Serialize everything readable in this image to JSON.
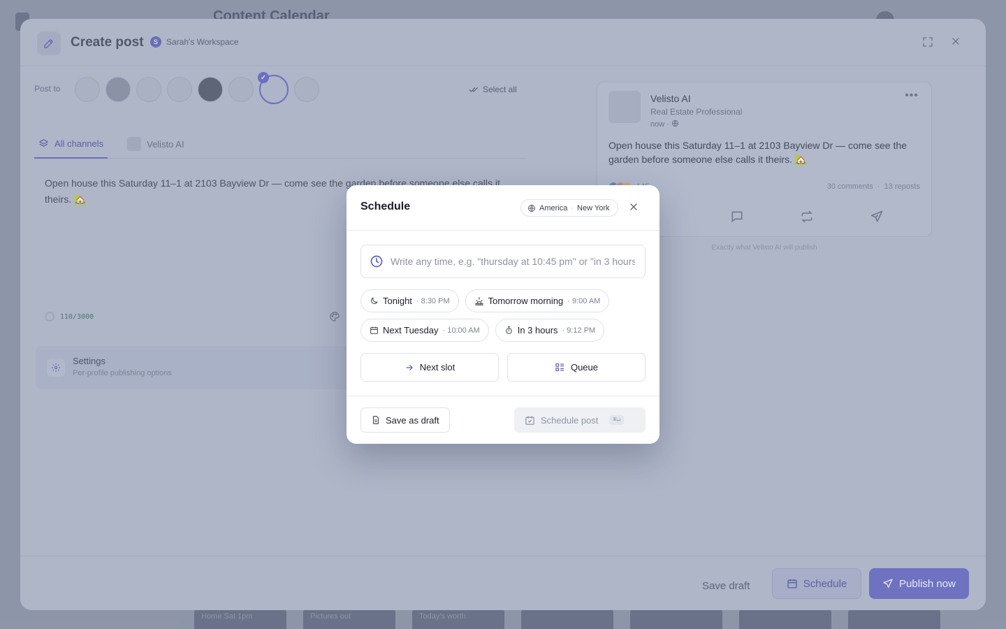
{
  "background": {
    "title": "Content Calendar",
    "cells": [
      "Home Sat 1pm",
      "Pictures out",
      "Today's worth",
      "",
      "",
      "",
      ""
    ]
  },
  "composer": {
    "title": "Create post",
    "workspace": {
      "initial": "S",
      "name": "Sarah's Workspace"
    },
    "post_to_label": "Post to",
    "select_all": "Select all",
    "tabs": [
      {
        "label": "All channels",
        "active": true
      },
      {
        "label": "Velisto AI",
        "active": false
      }
    ],
    "draft_text": "Open house this Saturday 11–1 at 2103 Bayview Dr — come see the garden before someone else calls it theirs. 🏡",
    "char_count": "110/3000",
    "settings": {
      "title": "Settings",
      "subtitle": "Per-profile publishing options"
    },
    "preview": {
      "name": "Velisto AI",
      "role": "Real Estate Professional",
      "time": "now ·",
      "text": "Open house this Saturday 11–1 at 2103 Bayview Dr — come see the garden before someone else calls it theirs. 🏡",
      "reactions": "145",
      "comments": "30 comments",
      "reposts": "13 reposts",
      "caption": "Exactly what Velisto AI will publish"
    },
    "footer": {
      "save_draft": "Save draft",
      "schedule": "Schedule",
      "publish_now": "Publish now"
    }
  },
  "schedule_modal": {
    "title": "Schedule",
    "timezone": {
      "region": "America",
      "city": "New York"
    },
    "input_placeholder": "Write any time, e.g. \"thursday at 10:45 pm\" or \"in 3 hours\"",
    "presets": [
      {
        "label": "Tonight",
        "time": "· 8:30 PM",
        "icon": "moon-icon"
      },
      {
        "label": "Tomorrow morning",
        "time": "· 9:00 AM",
        "icon": "sunrise-icon"
      },
      {
        "label": "Next Tuesday",
        "time": "· 10:00 AM",
        "icon": "calendar-icon"
      },
      {
        "label": "In 3 hours",
        "time": "· 9:12 PM",
        "icon": "stopwatch-icon"
      }
    ],
    "next_slot": "Next slot",
    "queue": "Queue",
    "save_as_draft": "Save as draft",
    "schedule_post": "Schedule post",
    "shortcut": "⌘↵"
  },
  "colors": {
    "accent": "#6a6fc0",
    "modal_bg": "#ffffff",
    "border": "#dfe2ea"
  }
}
